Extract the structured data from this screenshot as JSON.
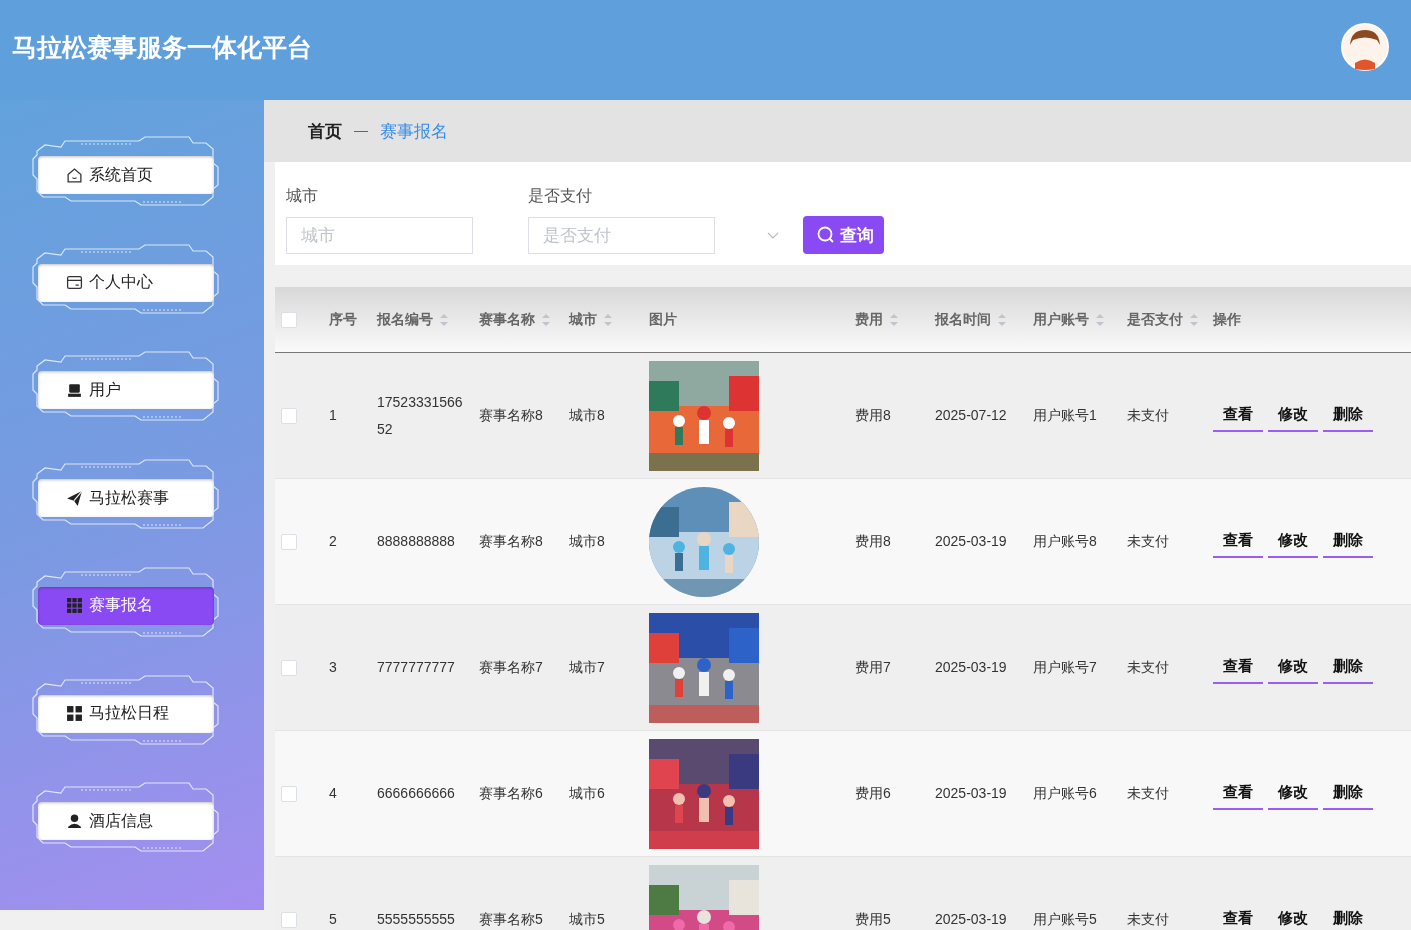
{
  "header": {
    "title": "马拉松赛事服务一体化平台"
  },
  "sidebar": {
    "items": [
      {
        "label": "系统首页",
        "selected": false
      },
      {
        "label": "个人中心",
        "selected": false
      },
      {
        "label": "用户",
        "selected": false
      },
      {
        "label": "马拉松赛事",
        "selected": false
      },
      {
        "label": "赛事报名",
        "selected": true
      },
      {
        "label": "马拉松日程",
        "selected": false
      },
      {
        "label": "酒店信息",
        "selected": false
      }
    ]
  },
  "breadcrumb": [
    {
      "label": "首页",
      "current": false
    },
    {
      "label": "赛事报名",
      "current": true
    }
  ],
  "search": {
    "fields": [
      {
        "label": "城市",
        "placeholder": "城市",
        "kind": "input"
      },
      {
        "label": "是否支付",
        "placeholder": "是否支付",
        "kind": "select"
      }
    ],
    "button": "查询"
  },
  "table": {
    "all_checked": false,
    "columns": [
      {
        "label": "序号",
        "sortable": false
      },
      {
        "label": "报名编号",
        "sortable": true
      },
      {
        "label": "赛事名称",
        "sortable": true
      },
      {
        "label": "城市",
        "sortable": true
      },
      {
        "label": "图片",
        "sortable": false
      },
      {
        "label": "费用",
        "sortable": true
      },
      {
        "label": "报名时间",
        "sortable": true
      },
      {
        "label": "用户账号",
        "sortable": true
      },
      {
        "label": "是否支付",
        "sortable": true
      },
      {
        "label": "操作",
        "sortable": false
      }
    ],
    "rows": [
      {
        "checked": false,
        "cells": [
          "1",
          "1752333156652",
          "赛事名称8",
          "城市8"
        ],
        "picture": {
          "kind": "picture"
        },
        "cells_after": [
          "费用8",
          "2025-07-12",
          "用户账号1",
          "未支付"
        ],
        "actions": [
          "查看",
          "修改",
          "删除"
        ]
      },
      {
        "checked": false,
        "cells": [
          "2",
          "8888888888",
          "赛事名称8",
          "城市8"
        ],
        "picture": {
          "kind": "picture"
        },
        "cells_after": [
          "费用8",
          "2025-03-19",
          "用户账号8",
          "未支付"
        ],
        "actions": [
          "查看",
          "修改",
          "删除"
        ]
      },
      {
        "checked": false,
        "cells": [
          "3",
          "7777777777",
          "赛事名称7",
          "城市7"
        ],
        "picture": {
          "kind": "picture"
        },
        "cells_after": [
          "费用7",
          "2025-03-19",
          "用户账号7",
          "未支付"
        ],
        "actions": [
          "查看",
          "修改",
          "删除"
        ]
      },
      {
        "checked": false,
        "cells": [
          "4",
          "6666666666",
          "赛事名称6",
          "城市6"
        ],
        "picture": {
          "kind": "picture"
        },
        "cells_after": [
          "费用6",
          "2025-03-19",
          "用户账号6",
          "未支付"
        ],
        "actions": [
          "查看",
          "修改",
          "删除"
        ]
      },
      {
        "checked": false,
        "cells": [
          "5",
          "5555555555",
          "赛事名称5",
          "城市5"
        ],
        "picture": {
          "kind": "picture"
        },
        "cells_after": [
          "费用5",
          "2025-03-19",
          "用户账号5",
          "未支付"
        ],
        "actions": [
          "查看",
          "修改",
          "删除"
        ]
      }
    ]
  }
}
